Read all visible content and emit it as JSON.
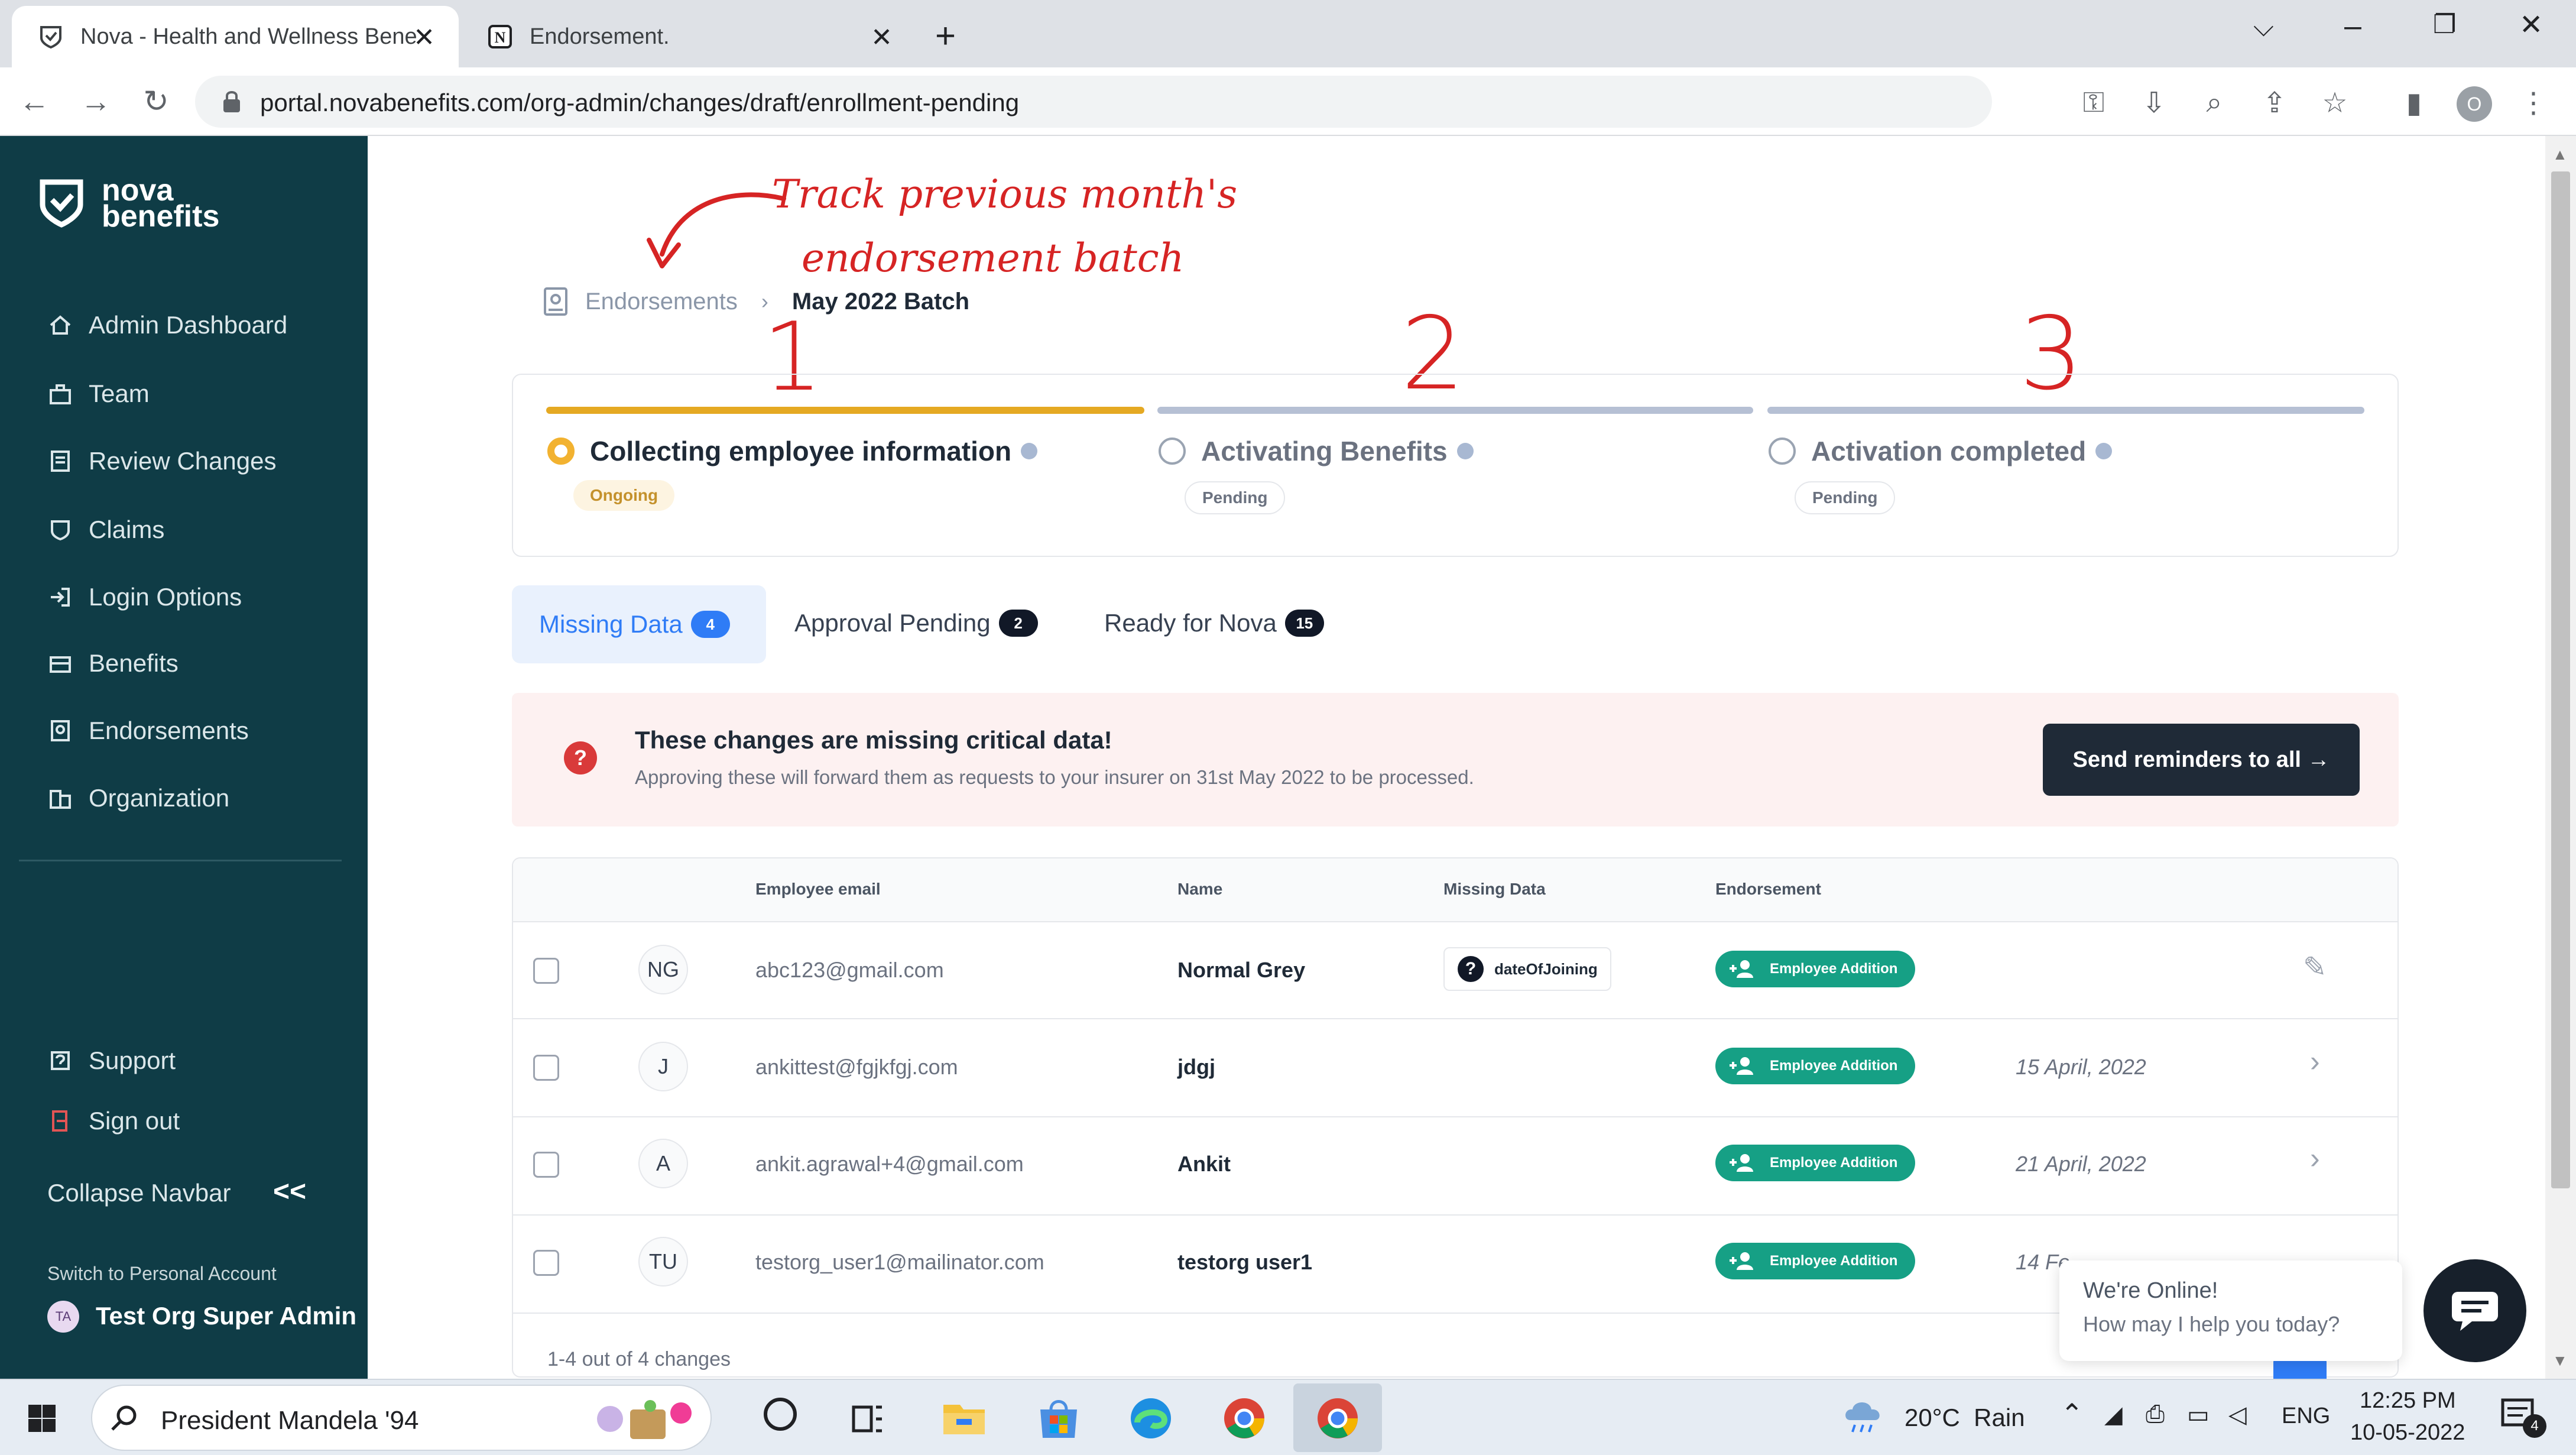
{
  "browser": {
    "tabs": [
      {
        "title": "Nova - Health and Wellness Bene",
        "active": true
      },
      {
        "title": "Endorsement.",
        "active": false
      }
    ],
    "new_tab": "+",
    "url": "portal.novabenefits.com/org-admin/changes/draft/enrollment-pending",
    "profile_initial": "O"
  },
  "sidebar": {
    "brand_line1": "nova",
    "brand_line2": "benefits",
    "items": [
      {
        "label": "Admin Dashboard",
        "icon": "home-icon"
      },
      {
        "label": "Team",
        "icon": "team-icon"
      },
      {
        "label": "Review Changes",
        "icon": "review-icon"
      },
      {
        "label": "Claims",
        "icon": "claims-icon"
      },
      {
        "label": "Login Options",
        "icon": "login-icon"
      },
      {
        "label": "Benefits",
        "icon": "benefits-icon"
      },
      {
        "label": "Endorsements",
        "icon": "endorsements-icon"
      },
      {
        "label": "Organization",
        "icon": "organization-icon"
      }
    ],
    "support": "Support",
    "sign_out": "Sign out",
    "collapse": "Collapse Navbar",
    "collapse_icon": "<<",
    "switch_account": "Switch to Personal Account",
    "user_initials": "TA",
    "user_name": "Test Org Super Admin"
  },
  "annotations": {
    "note_line1": "Track previous month's",
    "note_line2": "endorsement batch",
    "step1": "1",
    "step2": "2",
    "step3": "3"
  },
  "breadcrumb": {
    "parent": "Endorsements",
    "current": "May 2022 Batch"
  },
  "steps": [
    {
      "title": "Collecting employee information",
      "status": "Ongoing"
    },
    {
      "title": "Activating Benefits",
      "status": "Pending"
    },
    {
      "title": "Activation completed",
      "status": "Pending"
    }
  ],
  "tabs": [
    {
      "label": "Missing Data",
      "count": "4"
    },
    {
      "label": "Approval Pending",
      "count": "2"
    },
    {
      "label": "Ready for Nova",
      "count": "15"
    }
  ],
  "alert": {
    "title": "These changes are missing critical data!",
    "subtitle": "Approving these will forward them as requests to your insurer on 31st May 2022 to be processed.",
    "button": "Send reminders to all →"
  },
  "table": {
    "headers": [
      "Employee email",
      "Name",
      "Missing Data",
      "Endorsement"
    ],
    "rows": [
      {
        "initials": "NG",
        "email": "abc123@gmail.com",
        "name": "Normal Grey",
        "missing": "dateOfJoining",
        "endorsement": "Employee Addition",
        "date": ""
      },
      {
        "initials": "J",
        "email": "ankittest@fgjkfgj.com",
        "name": "jdgj",
        "missing": "",
        "endorsement": "Employee Addition",
        "date": "15 April, 2022"
      },
      {
        "initials": "A",
        "email": "ankit.agrawal+4@gmail.com",
        "name": "Ankit",
        "missing": "",
        "endorsement": "Employee Addition",
        "date": "21 April, 2022"
      },
      {
        "initials": "TU",
        "email": "testorg_user1@mailinator.com",
        "name": "testorg user1",
        "missing": "",
        "endorsement": "Employee Addition",
        "date": "14 Fe"
      }
    ],
    "footer": "1-4 out of 4 changes"
  },
  "chat": {
    "line1": "We're Online!",
    "line2": "How may I help you today?"
  },
  "taskbar": {
    "search_text": "President Mandela '94",
    "weather": "20°C  Rain",
    "lang": "ENG",
    "time": "12:25 PM",
    "date": "10-05-2022",
    "notifications": "4"
  },
  "colors": {
    "sidebar_bg": "#0f3c46",
    "step_active": "#f2b230",
    "step_inactive": "#b6c0d4",
    "accent_blue": "#2f7cf6",
    "alert_bg": "#fdf1f1",
    "pill_green": "#16a085",
    "dark_button": "#1f2a37",
    "annotation_red": "#d62424"
  }
}
